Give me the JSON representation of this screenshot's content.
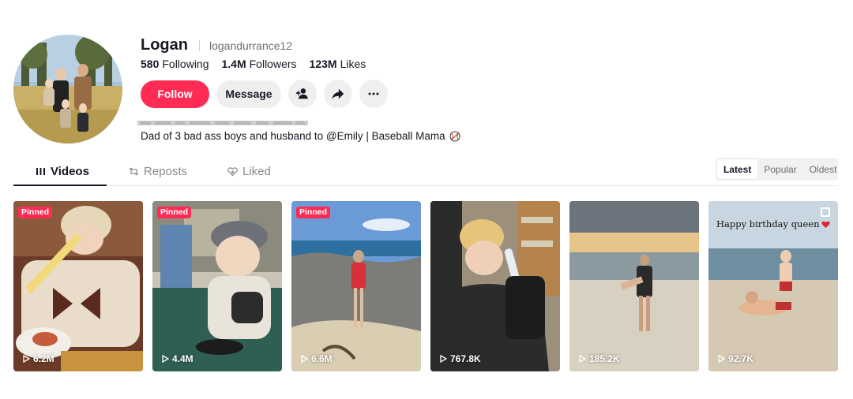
{
  "profile": {
    "display_name": "Logan",
    "username": "logandurrance12",
    "stats": [
      {
        "value": "580",
        "label": "Following"
      },
      {
        "value": "1.4M",
        "label": "Followers"
      },
      {
        "value": "123M",
        "label": "Likes"
      }
    ],
    "bio": "Dad of 3 bad ass boys and husband to @Emily | Baseball Mama"
  },
  "actions": {
    "follow_label": "Follow",
    "message_label": "Message",
    "icons": [
      "add-friend-icon",
      "share-icon",
      "more-icon"
    ]
  },
  "tabs": [
    {
      "label": "Videos",
      "icon": "grid-icon",
      "active": true
    },
    {
      "label": "Reposts",
      "icon": "repost-icon",
      "active": false
    },
    {
      "label": "Liked",
      "icon": "heart-icon",
      "active": false
    }
  ],
  "sort": {
    "options": [
      "Latest",
      "Popular",
      "Oldest"
    ],
    "selected": "Latest"
  },
  "videos": [
    {
      "pinned_label": "Pinned",
      "views": "6.2M"
    },
    {
      "pinned_label": "Pinned",
      "views": "4.4M"
    },
    {
      "pinned_label": "Pinned",
      "views": "6.6M"
    },
    {
      "pinned_label": "",
      "views": "767.8K"
    },
    {
      "pinned_label": "",
      "views": "185.2K"
    },
    {
      "pinned_label": "",
      "views": "92.7K",
      "caption": "Happy birthday queen"
    }
  ],
  "colors": {
    "accent": "#fe2c55",
    "text": "#161823",
    "muted": "#8a8b91",
    "button_bg": "#efefef"
  }
}
